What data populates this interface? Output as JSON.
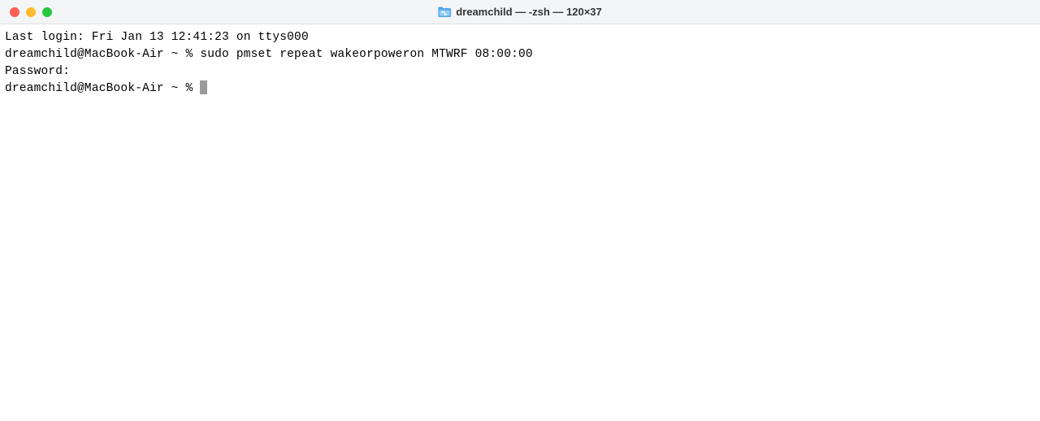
{
  "window": {
    "title": "dreamchild — -zsh — 120×37"
  },
  "terminal": {
    "last_login": "Last login: Fri Jan 13 12:41:23 on ttys000",
    "prompt1": "dreamchild@MacBook-Air ~ % ",
    "command1": "sudo pmset repeat wakeorpoweron MTWRF 08:00:00",
    "blank": "",
    "password_prompt": "Password:",
    "prompt2": "dreamchild@MacBook-Air ~ % "
  }
}
